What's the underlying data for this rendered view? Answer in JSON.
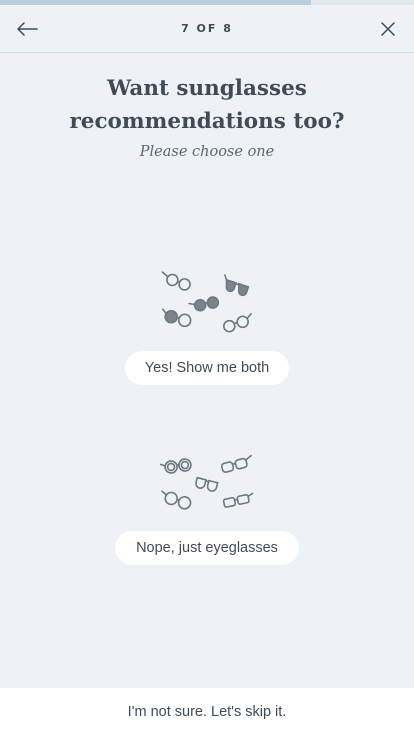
{
  "progress": {
    "value": 0.75
  },
  "header": {
    "step": "7 OF 8",
    "back_icon": "arrow-left-icon",
    "close_icon": "close-icon"
  },
  "question": {
    "title_line1": "Want sunglasses",
    "title_line2": "recommendations too?",
    "subtitle": "Please choose one"
  },
  "options": [
    {
      "label": "Yes! Show me both",
      "icon": "sunglasses-and-eyeglasses-icon"
    },
    {
      "label": "Nope, just eyeglasses",
      "icon": "eyeglasses-icon"
    }
  ],
  "footer": {
    "skip_label": "I'm not sure. Let's skip it."
  },
  "colors": {
    "background": "#eef2f6",
    "progress_fill": "#b9cdda",
    "text": "#414b56",
    "button": "#ffffff"
  }
}
